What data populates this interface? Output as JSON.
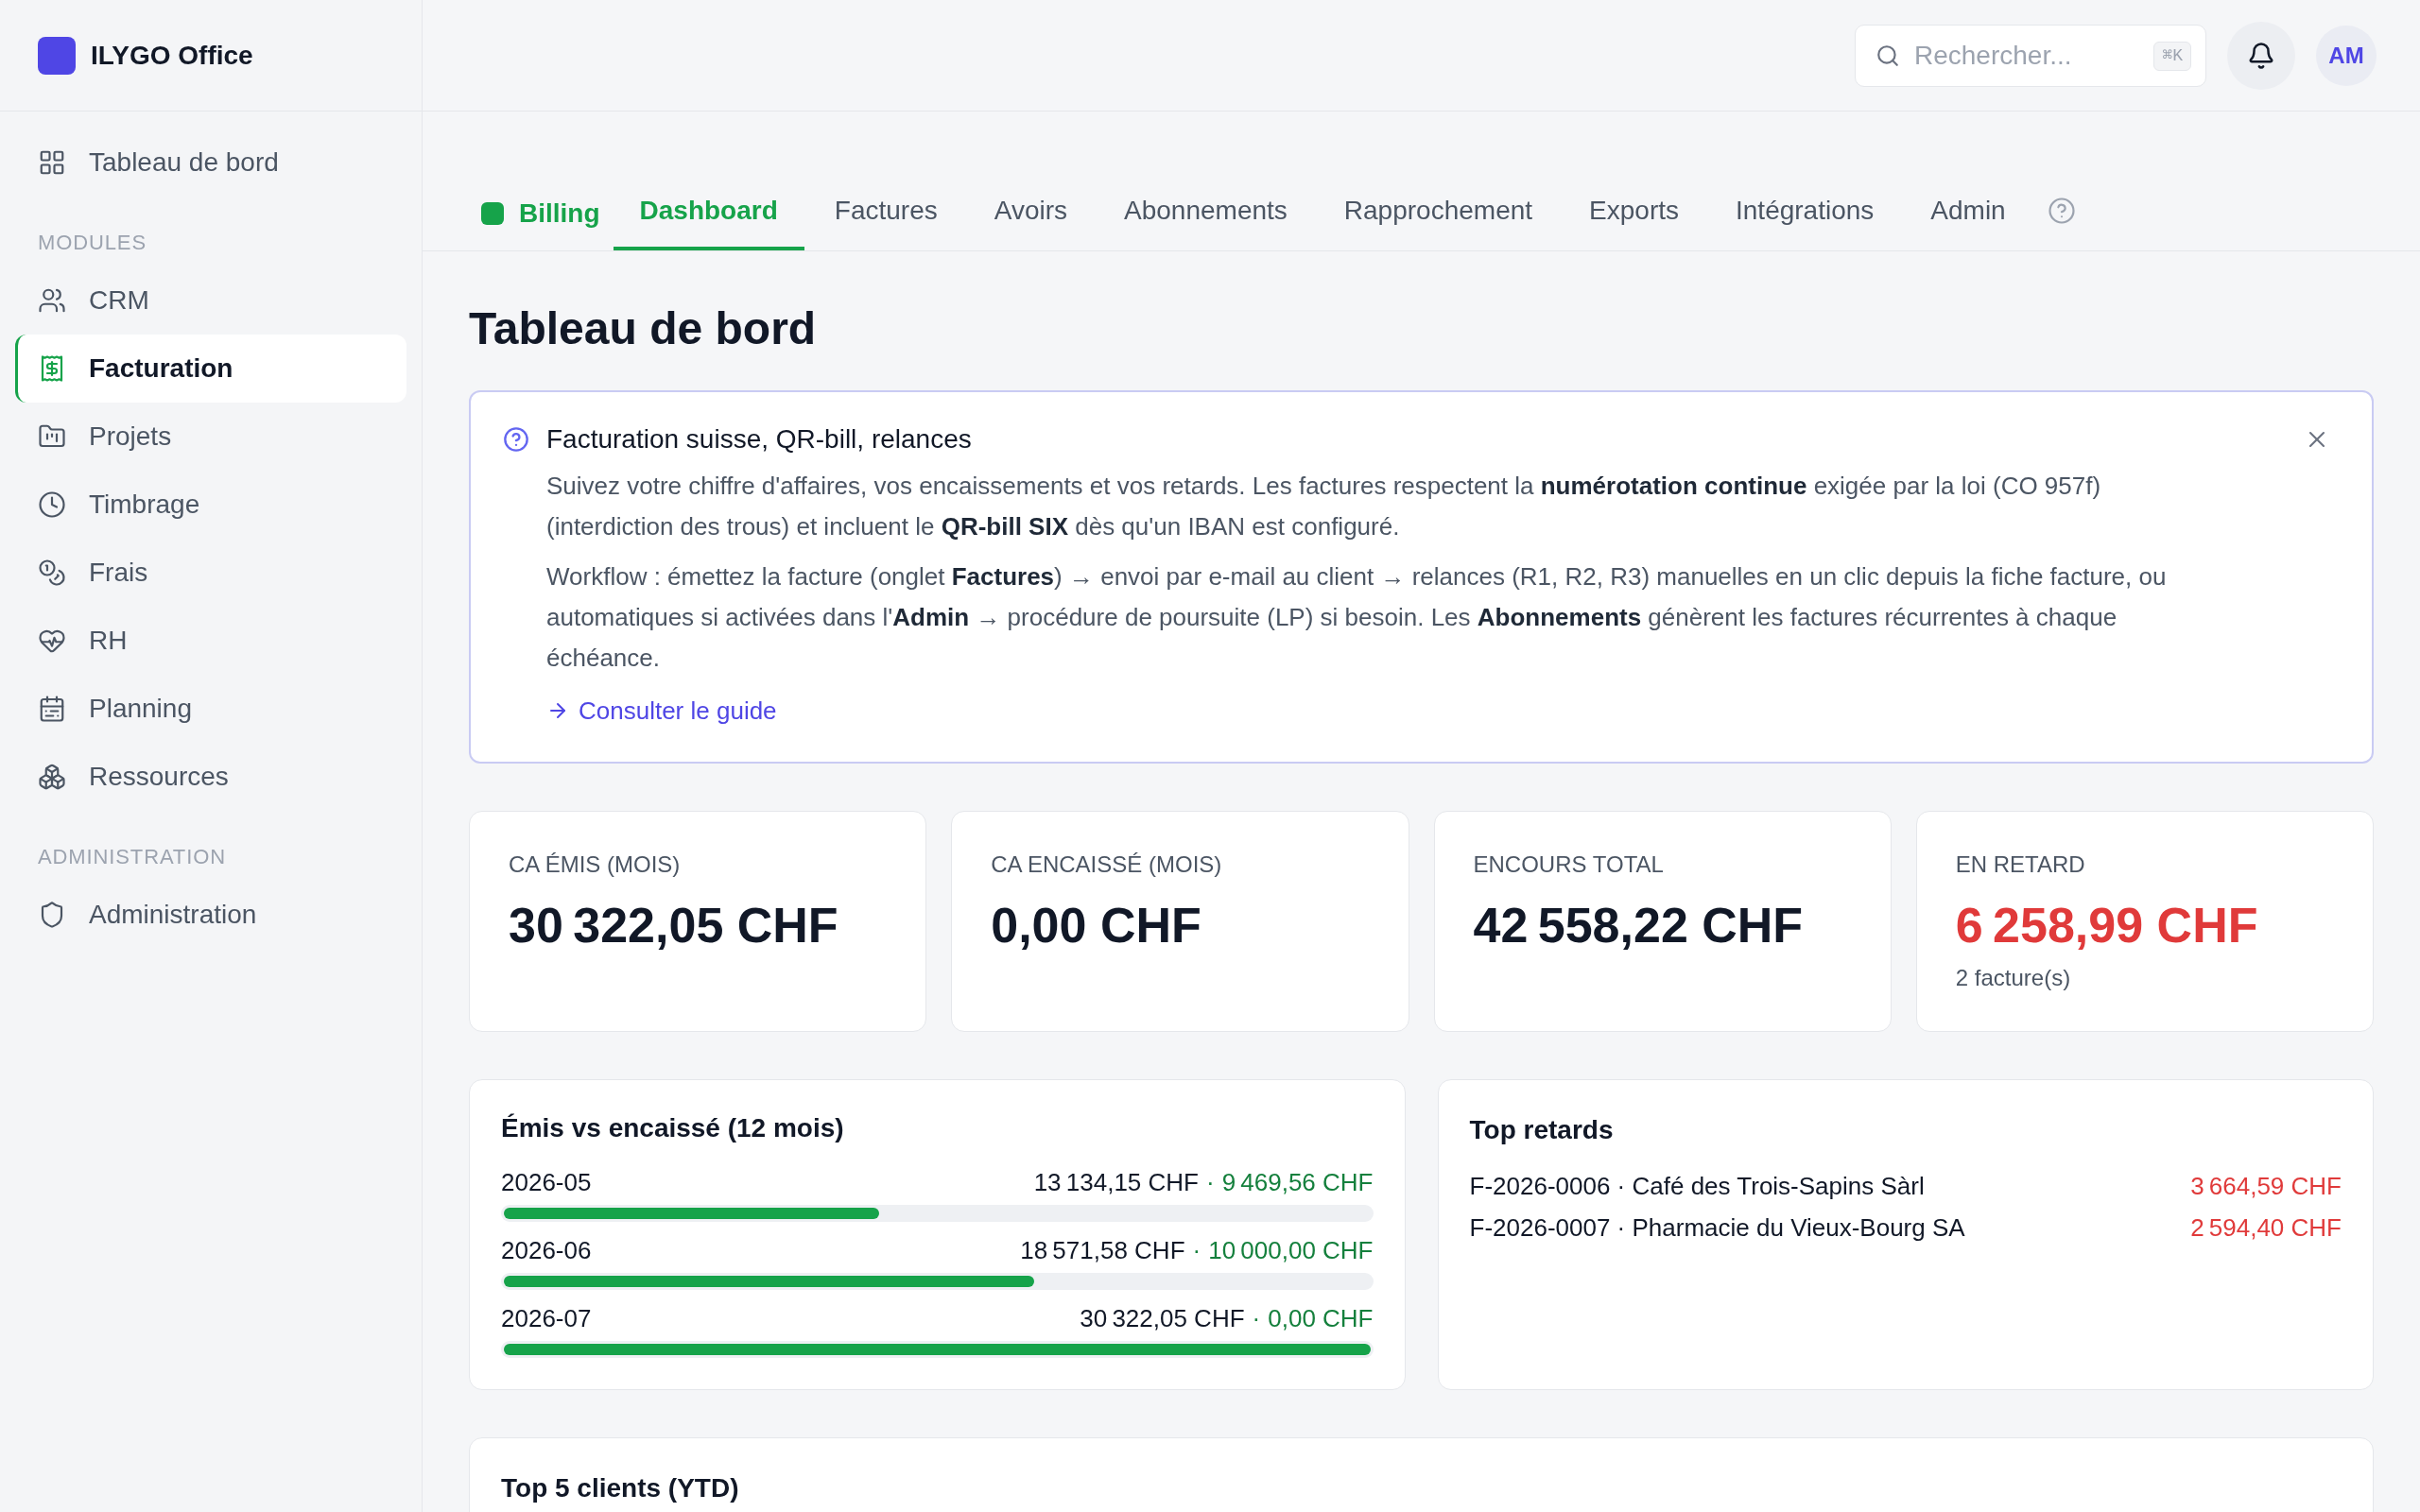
{
  "sidebar": {
    "brand": "ILYGO Office",
    "items": [
      {
        "label": "Tableau de bord",
        "selected": false
      }
    ],
    "sections": [
      {
        "title": "MODULES",
        "items": [
          {
            "label": "CRM",
            "selected": false
          },
          {
            "label": "Facturation",
            "selected": true
          },
          {
            "label": "Projets",
            "selected": false
          },
          {
            "label": "Timbrage",
            "selected": false
          },
          {
            "label": "Frais",
            "selected": false
          },
          {
            "label": "RH",
            "selected": false
          },
          {
            "label": "Planning",
            "selected": false
          },
          {
            "label": "Ressources",
            "selected": false
          }
        ]
      },
      {
        "title": "ADMINISTRATION",
        "items": [
          {
            "label": "Administration",
            "selected": false
          }
        ]
      }
    ]
  },
  "search": {
    "placeholder": "Rechercher...",
    "shortcut": "⌘K"
  },
  "user": {
    "initials": "AM"
  },
  "module": {
    "label": "Billing"
  },
  "tabs": [
    {
      "label": "Dashboard",
      "selected": true
    },
    {
      "label": "Factures",
      "selected": false
    },
    {
      "label": "Avoirs",
      "selected": false
    },
    {
      "label": "Abonnements",
      "selected": false
    },
    {
      "label": "Rapprochement",
      "selected": false
    },
    {
      "label": "Exports",
      "selected": false
    },
    {
      "label": "Intégrations",
      "selected": false
    },
    {
      "label": "Admin",
      "selected": false
    }
  ],
  "page_title": "Tableau de bord",
  "notice": {
    "title": "Facturation suisse, QR-bill, relances",
    "paragraphs": [
      "Suivez votre chiffre d'affaires, vos encaissements et vos retards. Les factures respectent la **numérotation continue** exigée par la loi (CO 957f) (interdiction des trous) et incluent le **QR-bill SIX** dès qu'un IBAN est configuré.",
      "Workflow : émettez la facture (onglet **Factures**) → envoi par e-mail au client → relances (R1, R2, R3) manuelles en un clic depuis la fiche facture, ou automatiques si activées dans l'**Admin** → procédure de poursuite (LP) si besoin. Les **Abonnements** génèrent les factures récurrentes à chaque échéance."
    ],
    "link": "Consulter le guide"
  },
  "kpis": [
    {
      "label": "CA ÉMIS (MOIS)",
      "value": "30 322,05 CHF",
      "kind": "plain"
    },
    {
      "label": "CA ENCAISSÉ (MOIS)",
      "value": "0,00 CHF",
      "kind": "plain"
    },
    {
      "label": "ENCOURS TOTAL",
      "value": "42 558,22 CHF",
      "kind": "plain"
    },
    {
      "label": "EN RETARD",
      "value": "6 258,99 CHF",
      "kind": "alert",
      "note": "2 facture(s)"
    }
  ],
  "monthly": {
    "title": "Émis vs encaissé (12 mois)",
    "rows": [
      {
        "month": "2026-05",
        "issued": "13 134,15 CHF",
        "separator": "·",
        "collected": "9 469,56 CHF",
        "level": 0.433
      },
      {
        "month": "2026-06",
        "issued": "18 571,58 CHF",
        "separator": "·",
        "collected": "10 000,00 CHF",
        "level": 0.6125
      },
      {
        "month": "2026-07",
        "issued": "30 322,05 CHF",
        "separator": "·",
        "collected": "0,00 CHF",
        "level": 1
      }
    ]
  },
  "overdue": {
    "title": "Top retards",
    "rows": [
      {
        "label": "F-2026-0006 · Café des Trois-Sapins Sàrl",
        "amount": "3 664,59 CHF"
      },
      {
        "label": "F-2026-0007 · Pharmacie du Vieux-Bourg SA",
        "amount": "2 594,40 CHF"
      }
    ]
  },
  "top_clients": {
    "title": "Top 5 clients (YTD)"
  }
}
